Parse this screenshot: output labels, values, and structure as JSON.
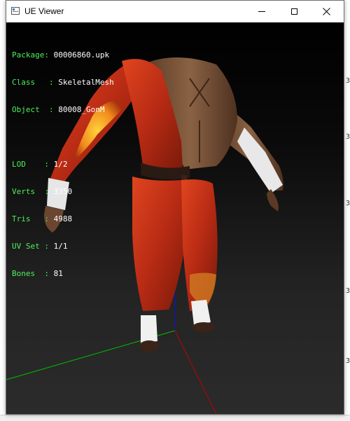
{
  "window": {
    "title": "UE Viewer"
  },
  "info": {
    "package_key": "Package",
    "package": "00006860.upk",
    "class_key": "Class",
    "class": "SkeletalMesh",
    "object_key": "Object",
    "object": "80008_GonM",
    "lod_key": "LOD",
    "lod": "1/2",
    "verts_key": "Verts",
    "verts": "3350",
    "tris_key": "Tris",
    "tris": "4988",
    "uvset_key": "UV Set",
    "uvset": "1/1",
    "bones_key": "Bones",
    "bones": "81"
  },
  "background_window": {
    "right_digits": [
      "3",
      "3",
      "3",
      "3",
      "3"
    ]
  },
  "colors": {
    "overlay_key": "#4df05a",
    "overlay_value": "#ffffff",
    "axis_x": "#cc0000",
    "axis_y": "#00cc00",
    "axis_z": "#0000cc",
    "robe": "#c8321a",
    "skin": "#7a5438"
  }
}
